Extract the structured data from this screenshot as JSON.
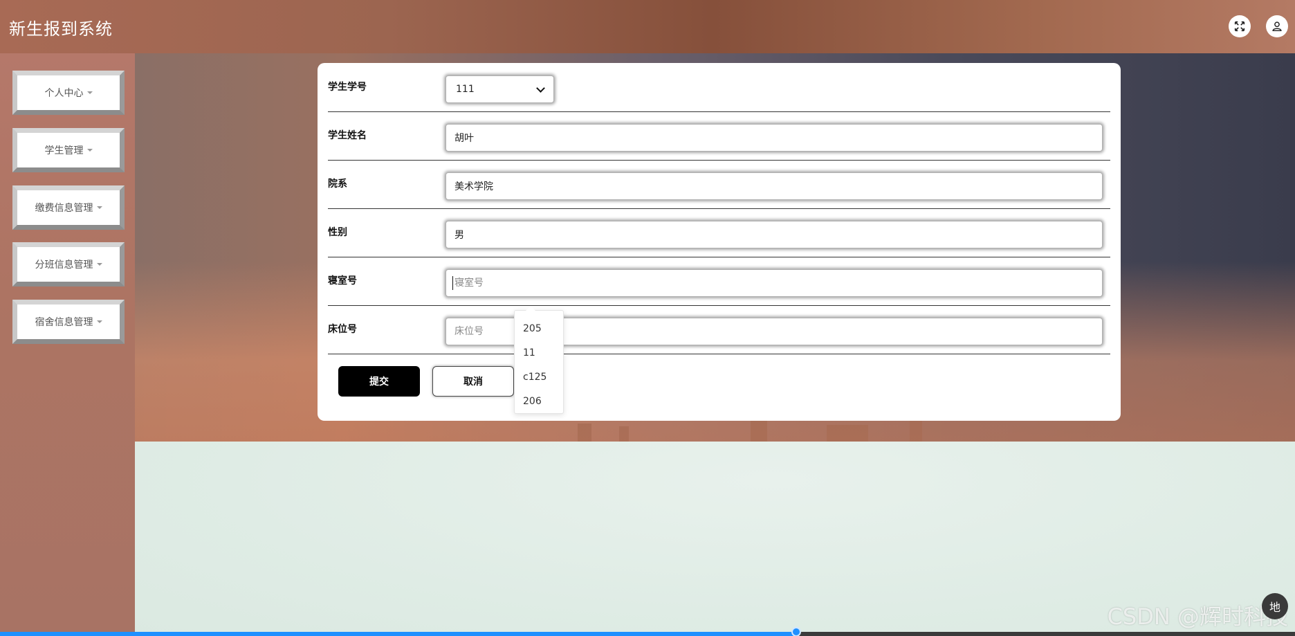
{
  "header": {
    "title": "新生报到系统",
    "icons": [
      "fullscreen-icon",
      "user-icon"
    ]
  },
  "sidebar": {
    "items": [
      {
        "label": "个人中心"
      },
      {
        "label": "学生管理"
      },
      {
        "label": "缴费信息管理"
      },
      {
        "label": "分班信息管理"
      },
      {
        "label": "宿舍信息管理"
      }
    ]
  },
  "form": {
    "student_id": {
      "label": "学生学号",
      "value": "111"
    },
    "student_name": {
      "label": "学生姓名",
      "value": "胡叶"
    },
    "department": {
      "label": "院系",
      "value": "美术学院"
    },
    "gender": {
      "label": "性别",
      "value": "男"
    },
    "dorm_number": {
      "label": "寝室号",
      "value": "",
      "placeholder": "寝室号"
    },
    "bed_number": {
      "label": "床位号",
      "value": "",
      "placeholder": "床位号"
    },
    "submit_label": "提交",
    "cancel_label": "取消"
  },
  "dorm_suggestions": [
    "205",
    "11",
    "c125",
    "206"
  ],
  "progress": {
    "fraction": 0.615
  },
  "watermark": "CSDN @辉时科技",
  "float_button_label": "地"
}
